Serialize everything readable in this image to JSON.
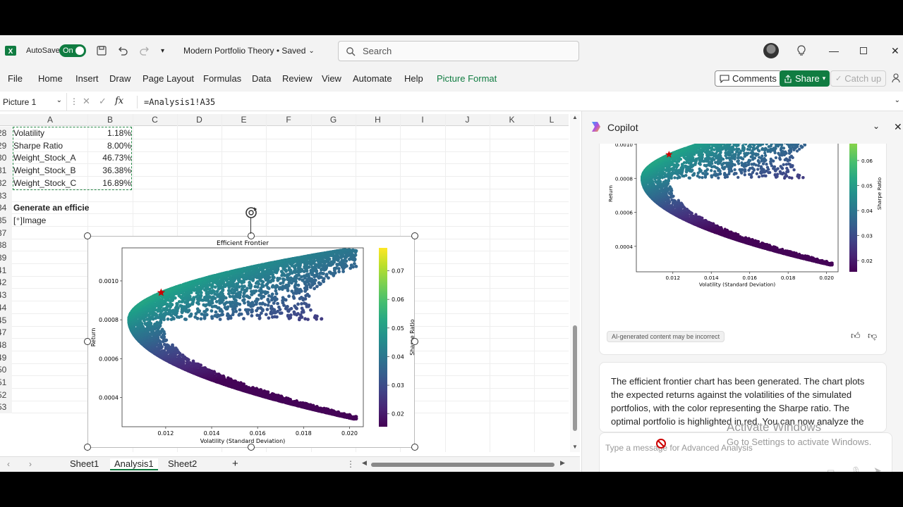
{
  "titlebar": {
    "autosave_label": "AutoSave",
    "autosave_state": "On",
    "doc_title": "Modern Portfolio Theory • Saved",
    "search_placeholder": "Search"
  },
  "menu": {
    "items": [
      "File",
      "Home",
      "Insert",
      "Draw",
      "Page Layout",
      "Formulas",
      "Data",
      "Review",
      "View",
      "Automate",
      "Help",
      "Picture Format"
    ],
    "comments": "Comments",
    "share": "Share",
    "catchup": "Catch up"
  },
  "formula_bar": {
    "name_box": "Picture 1",
    "fx": "fx",
    "formula": "=Analysis1!A35"
  },
  "grid": {
    "columns": [
      "A",
      "B",
      "C",
      "D",
      "E",
      "F",
      "G",
      "H",
      "I",
      "J",
      "K",
      "L"
    ],
    "rows": [
      {
        "num": "28",
        "a": "Volatility",
        "b": "1.18%"
      },
      {
        "num": "29",
        "a": "Sharpe Ratio",
        "b": "8.00%"
      },
      {
        "num": "30",
        "a": "Weight_Stock_A",
        "b": "46.73%"
      },
      {
        "num": "31",
        "a": "Weight_Stock_B",
        "b": "36.38%"
      },
      {
        "num": "32",
        "a": "Weight_Stock_C",
        "b": "16.89%"
      },
      {
        "num": "33",
        "a": "",
        "b": ""
      },
      {
        "num": "34",
        "a": "Generate an efficie",
        "b": ""
      },
      {
        "num": "35",
        "a": "[⁺]Image",
        "b": ""
      },
      {
        "num": "37",
        "a": "",
        "b": ""
      },
      {
        "num": "38",
        "a": "",
        "b": ""
      },
      {
        "num": "39",
        "a": "",
        "b": ""
      },
      {
        "num": "41",
        "a": "",
        "b": ""
      },
      {
        "num": "42",
        "a": "",
        "b": ""
      },
      {
        "num": "43",
        "a": "",
        "b": ""
      },
      {
        "num": "44",
        "a": "",
        "b": ""
      },
      {
        "num": "45",
        "a": "",
        "b": ""
      },
      {
        "num": "47",
        "a": "",
        "b": ""
      },
      {
        "num": "48",
        "a": "",
        "b": ""
      },
      {
        "num": "49",
        "a": "",
        "b": ""
      },
      {
        "num": "50",
        "a": "",
        "b": ""
      },
      {
        "num": "51",
        "a": "",
        "b": ""
      },
      {
        "num": "52",
        "a": "",
        "b": ""
      },
      {
        "num": "53",
        "a": "",
        "b": ""
      }
    ]
  },
  "sheets": [
    "Sheet1",
    "Analysis1",
    "Sheet2"
  ],
  "active_sheet": "Analysis1",
  "copilot": {
    "title": "Copilot",
    "disclaimer": "AI-generated content may be incorrect",
    "message": "The efficient frontier chart has been generated. The chart plots the expected returns against the volatilities of the simulated portfolios, with the color representing the Sharpe ratio. The optimal portfolio is highlighted in red. You can now analyze the",
    "input_placeholder": "Type a message for Advanced Analysis"
  },
  "watermark": {
    "line1": "Activate Windows",
    "line2": "Go to Settings to activate Windows."
  },
  "chart_data": {
    "type": "scatter",
    "title": "Efficient Frontier",
    "xlabel": "Volatility (Standard Deviation)",
    "ylabel": "Return",
    "colorbar_label": "Sharpe Ratio",
    "xlim": [
      0.0101,
      0.0206
    ],
    "ylim": [
      0.00025,
      0.00117
    ],
    "x_ticks": [
      "0.012",
      "0.014",
      "0.016",
      "0.018",
      "0.020"
    ],
    "x_tick_values": [
      0.012,
      0.014,
      0.016,
      0.018,
      0.02
    ],
    "y_ticks": [
      "0.0004",
      "0.0006",
      "0.0008",
      "0.0010"
    ],
    "y_tick_values": [
      0.0004,
      0.0006,
      0.0008,
      0.001
    ],
    "colorbar_ticks": [
      "0.02",
      "0.03",
      "0.04",
      "0.05",
      "0.06",
      "0.07"
    ],
    "colorbar_tick_values": [
      0.02,
      0.03,
      0.04,
      0.05,
      0.06,
      0.07
    ],
    "colorbar_range": [
      0.0155,
      0.078
    ],
    "colormap": "viridis",
    "frontier_vertex": [
      0.0104,
      0.0008
    ],
    "max_point": [
      0.0198,
      0.00116
    ],
    "min_point": [
      0.0202,
      0.00029
    ],
    "optimal_portfolio": {
      "x": 0.0118,
      "y": 0.00094,
      "color": "#cc0000"
    },
    "num_points": 6000
  },
  "colors": {
    "excel_green": "#107c41",
    "copilot_bg": "#f5f5f5"
  }
}
